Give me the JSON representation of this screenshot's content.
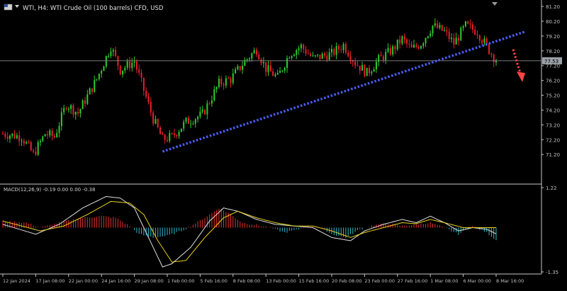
{
  "header": {
    "symbol_title": "WTI, H4:  WTI Crude Oil (100 barrels) CFD, USD"
  },
  "macd_label": "MACD(12,26,9) -0.19 0.00 0.00 -0.38",
  "colors": {
    "background": "#000000",
    "bull": "#2ecc2e",
    "bear": "#e8202a",
    "trendline": "#4a5cf0",
    "arrow": "#ff4444",
    "macd_line": "#e0e0e0",
    "signal_line": "#e8d020",
    "hist_positive": "#e83030",
    "hist_negative": "#30b8c8",
    "axis_text": "#c0c0c0",
    "price_badge": "#9aa0a6"
  },
  "chart_data": [
    {
      "type": "candlestick",
      "title": "WTI, H4:  WTI Crude Oil (100 barrels) CFD, USD",
      "ylim": [
        70.3,
        81.3
      ],
      "y_ticks": [
        "81.20",
        "80.20",
        "79.20",
        "78.20",
        "77.20",
        "76.20",
        "75.20",
        "74.20",
        "73.20",
        "72.20",
        "71.20"
      ],
      "x_ticks": [
        "12 Jan 2024",
        "17 Jan 08:00",
        "22 Jan 00:00",
        "24 Jan 16:00",
        "29 Jan 08:00",
        "1 Feb 00:00",
        "5 Feb 16:00",
        "8 Feb 08:00",
        "13 Feb 00:00",
        "15 Feb 16:00",
        "20 Feb 08:00",
        "23 Feb 00:00",
        "27 Feb 16:00",
        "1 Mar 08:00",
        "6 Mar 00:00",
        "8 Mar 16:00"
      ],
      "current_price": "77.53",
      "current_price_value": 77.53,
      "anchors": [
        [
          0,
          72.6
        ],
        [
          8,
          72.4
        ],
        [
          13,
          71.2
        ],
        [
          18,
          72.6
        ],
        [
          22,
          72.4
        ],
        [
          27,
          74.6
        ],
        [
          32,
          74.0
        ],
        [
          40,
          76.3
        ],
        [
          46,
          78.5
        ],
        [
          50,
          76.9
        ],
        [
          56,
          77.5
        ],
        [
          64,
          73.6
        ],
        [
          68,
          72.2
        ],
        [
          72,
          72.4
        ],
        [
          78,
          73.4
        ],
        [
          85,
          73.9
        ],
        [
          92,
          76.0
        ],
        [
          97,
          76.3
        ],
        [
          103,
          77.5
        ],
        [
          108,
          78.3
        ],
        [
          112,
          77.0
        ],
        [
          117,
          76.4
        ],
        [
          122,
          78.0
        ],
        [
          127,
          78.5
        ],
        [
          132,
          77.7
        ],
        [
          140,
          78.0
        ],
        [
          145,
          78.6
        ],
        [
          150,
          77.4
        ],
        [
          155,
          76.7
        ],
        [
          160,
          77.6
        ],
        [
          166,
          78.3
        ],
        [
          170,
          79.0
        ],
        [
          174,
          78.3
        ],
        [
          178,
          78.7
        ],
        [
          183,
          79.9
        ],
        [
          188,
          79.5
        ],
        [
          192,
          78.7
        ],
        [
          197,
          79.9
        ],
        [
          202,
          79.5
        ],
        [
          206,
          78.5
        ],
        [
          210,
          77.53
        ]
      ],
      "highlight": "dotted ascending trendline with red dotted arrow pointing down-right"
    },
    {
      "type": "macd",
      "label": "MACD(12,26,9) -0.19 0.00 0.00 -0.38",
      "ylim": [
        -1.35,
        1.22
      ],
      "y_ticks": [
        "1.22",
        "-1.35"
      ],
      "hist_anchors": [
        [
          0,
          0.2
        ],
        [
          10,
          0.15
        ],
        [
          16,
          0.0
        ],
        [
          24,
          0.15
        ],
        [
          34,
          0.3
        ],
        [
          42,
          0.35
        ],
        [
          48,
          0.3
        ],
        [
          54,
          0.05
        ],
        [
          58,
          -0.2
        ],
        [
          64,
          -0.3
        ],
        [
          70,
          -0.25
        ],
        [
          76,
          -0.1
        ],
        [
          80,
          0.05
        ],
        [
          86,
          0.3
        ],
        [
          92,
          0.6
        ],
        [
          96,
          0.45
        ],
        [
          102,
          0.15
        ],
        [
          108,
          0.08
        ],
        [
          114,
          0.0
        ],
        [
          120,
          -0.15
        ],
        [
          126,
          -0.05
        ],
        [
          130,
          0.05
        ],
        [
          136,
          0.0
        ],
        [
          140,
          -0.2
        ],
        [
          146,
          -0.3
        ],
        [
          152,
          -0.05
        ],
        [
          158,
          0.08
        ],
        [
          164,
          0.12
        ],
        [
          170,
          0.05
        ],
        [
          176,
          0.1
        ],
        [
          182,
          0.15
        ],
        [
          188,
          0.0
        ],
        [
          194,
          -0.2
        ],
        [
          200,
          0.05
        ],
        [
          206,
          -0.15
        ],
        [
          210,
          -0.38
        ]
      ],
      "macd_anchors": [
        [
          0,
          0.1
        ],
        [
          14,
          -0.2
        ],
        [
          24,
          0.1
        ],
        [
          34,
          0.6
        ],
        [
          44,
          0.95
        ],
        [
          50,
          0.9
        ],
        [
          56,
          0.6
        ],
        [
          62,
          -0.3
        ],
        [
          68,
          -1.2
        ],
        [
          72,
          -1.1
        ],
        [
          80,
          -0.6
        ],
        [
          88,
          0.2
        ],
        [
          94,
          0.6
        ],
        [
          100,
          0.5
        ],
        [
          108,
          0.25
        ],
        [
          116,
          0.1
        ],
        [
          124,
          0.05
        ],
        [
          132,
          0.0
        ],
        [
          140,
          -0.3
        ],
        [
          148,
          -0.4
        ],
        [
          154,
          -0.1
        ],
        [
          162,
          0.1
        ],
        [
          170,
          0.25
        ],
        [
          176,
          0.15
        ],
        [
          182,
          0.35
        ],
        [
          188,
          0.15
        ],
        [
          194,
          -0.1
        ],
        [
          200,
          0.0
        ],
        [
          206,
          -0.05
        ],
        [
          210,
          -0.19
        ]
      ],
      "signal_anchors": [
        [
          0,
          0.2
        ],
        [
          16,
          -0.1
        ],
        [
          26,
          0.05
        ],
        [
          36,
          0.4
        ],
        [
          46,
          0.8
        ],
        [
          54,
          0.75
        ],
        [
          60,
          0.4
        ],
        [
          66,
          -0.4
        ],
        [
          72,
          -1.05
        ],
        [
          78,
          -1.0
        ],
        [
          86,
          -0.3
        ],
        [
          94,
          0.3
        ],
        [
          100,
          0.5
        ],
        [
          108,
          0.3
        ],
        [
          116,
          0.15
        ],
        [
          124,
          0.05
        ],
        [
          132,
          0.05
        ],
        [
          140,
          -0.1
        ],
        [
          148,
          -0.3
        ],
        [
          154,
          -0.15
        ],
        [
          162,
          0.0
        ],
        [
          170,
          0.15
        ],
        [
          176,
          0.12
        ],
        [
          182,
          0.25
        ],
        [
          188,
          0.15
        ],
        [
          196,
          0.0
        ],
        [
          204,
          0.0
        ],
        [
          210,
          0.0
        ]
      ]
    }
  ]
}
